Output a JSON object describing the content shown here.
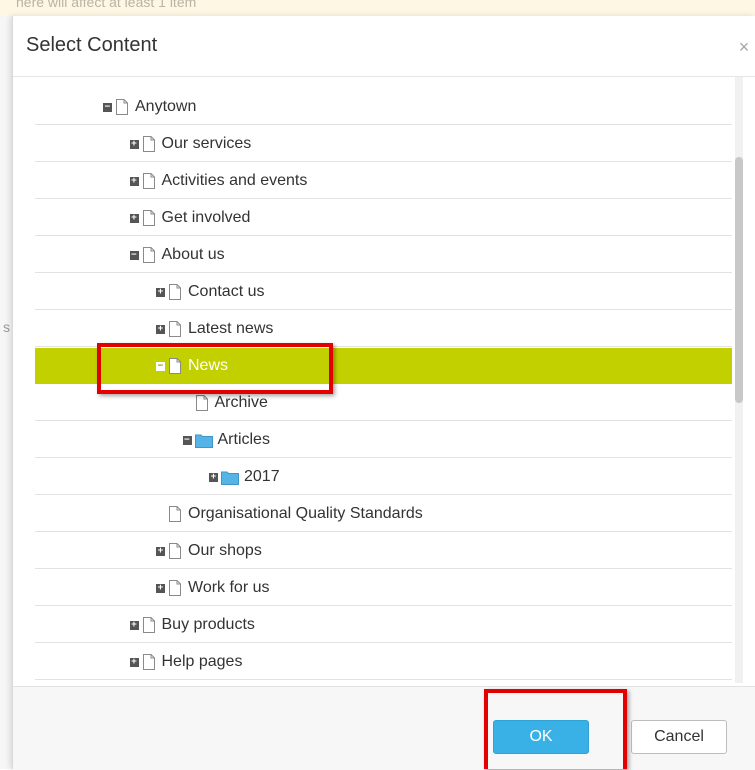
{
  "background": {
    "partial_text": "nere will affect at least 1 item",
    "side_letter": "s"
  },
  "dialog": {
    "title": "Select Content",
    "close_glyph": "×",
    "ok_label": "OK",
    "cancel_label": "Cancel"
  },
  "tree": [
    {
      "label": "Anytown",
      "toggle": "−",
      "icon": "page",
      "depth": 0,
      "selected": false
    },
    {
      "label": "Our services",
      "toggle": "+",
      "icon": "page",
      "depth": 1,
      "selected": false
    },
    {
      "label": "Activities and events",
      "toggle": "+",
      "icon": "page",
      "depth": 1,
      "selected": false
    },
    {
      "label": "Get involved",
      "toggle": "+",
      "icon": "page",
      "depth": 1,
      "selected": false
    },
    {
      "label": "About us",
      "toggle": "−",
      "icon": "page",
      "depth": 1,
      "selected": false
    },
    {
      "label": "Contact us",
      "toggle": "+",
      "icon": "page",
      "depth": 2,
      "selected": false
    },
    {
      "label": "Latest news",
      "toggle": "+",
      "icon": "page",
      "depth": 2,
      "selected": false
    },
    {
      "label": "News",
      "toggle": "−",
      "icon": "page",
      "depth": 2,
      "selected": true
    },
    {
      "label": "Archive",
      "toggle": "",
      "icon": "page",
      "depth": 3,
      "selected": false
    },
    {
      "label": "Articles",
      "toggle": "−",
      "icon": "folder",
      "depth": 3,
      "selected": false
    },
    {
      "label": "2017",
      "toggle": "+",
      "icon": "folder",
      "depth": 4,
      "selected": false
    },
    {
      "label": "Organisational Quality Standards",
      "toggle": "",
      "icon": "page",
      "depth": 2,
      "selected": false
    },
    {
      "label": "Our shops",
      "toggle": "+",
      "icon": "page",
      "depth": 2,
      "selected": false
    },
    {
      "label": "Work for us",
      "toggle": "+",
      "icon": "page",
      "depth": 2,
      "selected": false
    },
    {
      "label": "Buy products",
      "toggle": "+",
      "icon": "page",
      "depth": 1,
      "selected": false
    },
    {
      "label": "Help pages",
      "toggle": "+",
      "icon": "page",
      "depth": 1,
      "selected": false
    }
  ],
  "colors": {
    "selected_row": "#c3d000",
    "ok_button": "#39b0e6",
    "highlight_box": "#e30000",
    "folder": "#55b4e6"
  }
}
